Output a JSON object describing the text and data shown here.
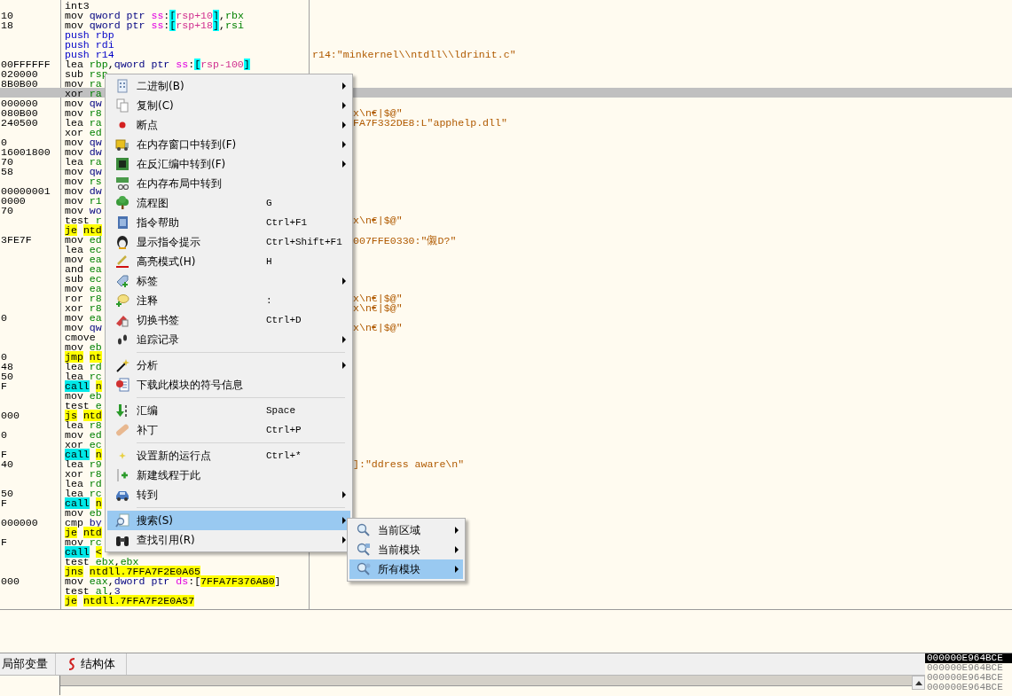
{
  "disassembly": {
    "rows": [
      {
        "code": [
          {
            "kind": "op",
            "text": "int3"
          }
        ],
        "selected": false
      },
      {
        "address": "10",
        "code": [
          {
            "kind": "op",
            "text": "mov "
          },
          {
            "kind": "ptr",
            "text": "qword ptr "
          },
          {
            "kind": "seg",
            "text": "ss"
          },
          {
            "kind": "op",
            "text": ":"
          },
          {
            "kind": "brk",
            "text": "["
          },
          {
            "kind": "mem",
            "text": "rsp+10"
          },
          {
            "kind": "brk",
            "text": "]"
          },
          {
            "kind": "op",
            "text": ","
          },
          {
            "kind": "reg",
            "text": "rbx"
          }
        ],
        "selected": false
      },
      {
        "address": "18",
        "code": [
          {
            "kind": "op",
            "text": "mov "
          },
          {
            "kind": "ptr",
            "text": "qword ptr "
          },
          {
            "kind": "seg",
            "text": "ss"
          },
          {
            "kind": "op",
            "text": ":"
          },
          {
            "kind": "brk",
            "text": "["
          },
          {
            "kind": "mem",
            "text": "rsp+18"
          },
          {
            "kind": "brk",
            "text": "]"
          },
          {
            "kind": "op",
            "text": ","
          },
          {
            "kind": "reg",
            "text": "rsi"
          }
        ],
        "selected": false
      },
      {
        "code": [
          {
            "kind": "stack",
            "text": "push rbp"
          }
        ],
        "selected": false
      },
      {
        "code": [
          {
            "kind": "stack",
            "text": "push rdi"
          }
        ],
        "selected": false
      },
      {
        "code": [
          {
            "kind": "stack",
            "text": "push r14"
          }
        ],
        "comment": "r14:\"minkernel\\\\ntdll\\\\ldrinit.c\"",
        "selected": false
      },
      {
        "address": "00FFFFFF",
        "code": [
          {
            "kind": "op",
            "text": "lea "
          },
          {
            "kind": "reg",
            "text": "rbp"
          },
          {
            "kind": "op",
            "text": ","
          },
          {
            "kind": "ptr",
            "text": "qword ptr "
          },
          {
            "kind": "seg",
            "text": "ss"
          },
          {
            "kind": "op",
            "text": ":"
          },
          {
            "kind": "brk",
            "text": "["
          },
          {
            "kind": "mem",
            "text": "rsp-100"
          },
          {
            "kind": "brk",
            "text": "]"
          }
        ],
        "selected": false
      },
      {
        "address": "020000",
        "code": [
          {
            "kind": "op",
            "text": "sub "
          },
          {
            "kind": "reg",
            "text": "rsp"
          }
        ],
        "selected": false
      },
      {
        "address": "8B0B00",
        "code": [
          {
            "kind": "op",
            "text": "mov "
          },
          {
            "kind": "reg",
            "text": "ra"
          }
        ],
        "selected": false
      },
      {
        "code": [
          {
            "kind": "op",
            "text": "xor "
          },
          {
            "kind": "reg",
            "text": "ra"
          }
        ],
        "selected": true
      },
      {
        "address": "000000",
        "code": [
          {
            "kind": "op",
            "text": "mov "
          },
          {
            "kind": "ptr",
            "text": "qw"
          }
        ],
        "selected": false
      },
      {
        "address": "080B00",
        "code": [
          {
            "kind": "op",
            "text": "mov "
          },
          {
            "kind": "reg",
            "text": "r8"
          }
        ],
        "comment": "x\\n€|$@\"",
        "selected": false
      },
      {
        "address": "240500",
        "code": [
          {
            "kind": "op",
            "text": "lea "
          },
          {
            "kind": "reg",
            "text": "ra"
          }
        ],
        "comment": "FA7F332DE8:L\"apphelp.dll\"",
        "selected": false
      },
      {
        "code": [
          {
            "kind": "op",
            "text": "xor "
          },
          {
            "kind": "reg",
            "text": "ed"
          }
        ],
        "selected": false
      },
      {
        "address": "0",
        "code": [
          {
            "kind": "op",
            "text": "mov "
          },
          {
            "kind": "ptr",
            "text": "qw"
          }
        ],
        "selected": false
      },
      {
        "address": "16001800",
        "code": [
          {
            "kind": "op",
            "text": "mov "
          },
          {
            "kind": "ptr",
            "text": "dw"
          }
        ],
        "selected": false
      },
      {
        "address": "70",
        "code": [
          {
            "kind": "op",
            "text": "lea "
          },
          {
            "kind": "reg",
            "text": "ra"
          }
        ],
        "selected": false
      },
      {
        "address": "58",
        "code": [
          {
            "kind": "op",
            "text": "mov "
          },
          {
            "kind": "ptr",
            "text": "qw"
          }
        ],
        "selected": false
      },
      {
        "code": [
          {
            "kind": "op",
            "text": "mov "
          },
          {
            "kind": "reg",
            "text": "rs"
          }
        ],
        "selected": false
      },
      {
        "address": "00000001",
        "code": [
          {
            "kind": "op",
            "text": "mov "
          },
          {
            "kind": "ptr",
            "text": "dw"
          }
        ],
        "selected": false
      },
      {
        "address": "0000",
        "code": [
          {
            "kind": "op",
            "text": "mov "
          },
          {
            "kind": "reg",
            "text": "r1"
          }
        ],
        "selected": false
      },
      {
        "address": "70",
        "code": [
          {
            "kind": "op",
            "text": "mov "
          },
          {
            "kind": "ptr",
            "text": "wo"
          }
        ],
        "selected": false
      },
      {
        "code": [
          {
            "kind": "op",
            "text": "test "
          },
          {
            "kind": "reg",
            "text": "r"
          }
        ],
        "comment": "x\\n€|$@\"",
        "selected": false
      },
      {
        "code": [
          {
            "kind": "jmp",
            "text": "je"
          },
          {
            "kind": "tgt",
            "text": "ntd"
          }
        ],
        "selected": false
      },
      {
        "address": "3FE7F",
        "code": [
          {
            "kind": "op",
            "text": "mov "
          },
          {
            "kind": "reg",
            "text": "ed"
          }
        ],
        "comment": "007FFE0330:\"儭D?\"",
        "selected": false
      },
      {
        "code": [
          {
            "kind": "op",
            "text": "lea "
          },
          {
            "kind": "reg",
            "text": "ec"
          }
        ],
        "selected": false
      },
      {
        "code": [
          {
            "kind": "op",
            "text": "mov "
          },
          {
            "kind": "reg",
            "text": "ea"
          }
        ],
        "selected": false
      },
      {
        "code": [
          {
            "kind": "op",
            "text": "and "
          },
          {
            "kind": "reg",
            "text": "ea"
          }
        ],
        "selected": false
      },
      {
        "code": [
          {
            "kind": "op",
            "text": "sub "
          },
          {
            "kind": "reg",
            "text": "ec"
          }
        ],
        "selected": false
      },
      {
        "code": [
          {
            "kind": "op",
            "text": "mov "
          },
          {
            "kind": "reg",
            "text": "ea"
          }
        ],
        "selected": false
      },
      {
        "code": [
          {
            "kind": "op",
            "text": "ror "
          },
          {
            "kind": "reg",
            "text": "r8"
          }
        ],
        "comment": "x\\n€|$@\"",
        "selected": false
      },
      {
        "code": [
          {
            "kind": "op",
            "text": "xor "
          },
          {
            "kind": "reg",
            "text": "r8"
          }
        ],
        "comment": "x\\n€|$@\"",
        "selected": false
      },
      {
        "address": "0",
        "code": [
          {
            "kind": "op",
            "text": "mov "
          },
          {
            "kind": "reg",
            "text": "ea"
          }
        ],
        "selected": false
      },
      {
        "code": [
          {
            "kind": "op",
            "text": "mov "
          },
          {
            "kind": "ptr",
            "text": "qw"
          }
        ],
        "comment": "x\\n€|$@\"",
        "selected": false
      },
      {
        "code": [
          {
            "kind": "op",
            "text": "cmove"
          }
        ],
        "selected": false
      },
      {
        "code": [
          {
            "kind": "op",
            "text": "mov "
          },
          {
            "kind": "reg",
            "text": "eb"
          }
        ],
        "selected": false
      },
      {
        "address": "0",
        "code": [
          {
            "kind": "jmp",
            "text": "jmp"
          },
          {
            "kind": "tgt",
            "text": "nt"
          }
        ],
        "selected": false
      },
      {
        "address": "48",
        "code": [
          {
            "kind": "op",
            "text": "lea "
          },
          {
            "kind": "reg",
            "text": "rd"
          }
        ],
        "selected": false
      },
      {
        "address": "50",
        "code": [
          {
            "kind": "op",
            "text": "lea "
          },
          {
            "kind": "reg",
            "text": "rc"
          }
        ],
        "selected": false
      },
      {
        "address": "F",
        "code": [
          {
            "kind": "call",
            "text": "call"
          },
          {
            "kind": "tgt",
            "text": "n"
          }
        ],
        "selected": false
      },
      {
        "code": [
          {
            "kind": "op",
            "text": "mov "
          },
          {
            "kind": "reg",
            "text": "eb"
          }
        ],
        "selected": false
      },
      {
        "code": [
          {
            "kind": "op",
            "text": "test "
          },
          {
            "kind": "reg",
            "text": "e"
          }
        ],
        "selected": false
      },
      {
        "address": "000",
        "code": [
          {
            "kind": "jmp",
            "text": "js"
          },
          {
            "kind": "tgt",
            "text": "ntd"
          }
        ],
        "selected": false
      },
      {
        "code": [
          {
            "kind": "op",
            "text": "lea "
          },
          {
            "kind": "reg",
            "text": "r8"
          }
        ],
        "selected": false
      },
      {
        "address": "0",
        "code": [
          {
            "kind": "op",
            "text": "mov "
          },
          {
            "kind": "reg",
            "text": "ed"
          }
        ],
        "selected": false
      },
      {
        "code": [
          {
            "kind": "op",
            "text": "xor "
          },
          {
            "kind": "reg",
            "text": "ec"
          }
        ],
        "selected": false
      },
      {
        "address": "F",
        "code": [
          {
            "kind": "call",
            "text": "call"
          },
          {
            "kind": "tgt",
            "text": "n"
          }
        ],
        "selected": false
      },
      {
        "address": "40",
        "code": [
          {
            "kind": "op",
            "text": "lea "
          },
          {
            "kind": "reg",
            "text": "r9"
          }
        ],
        "comment": "]:\"ddress aware\\n\"",
        "selected": false
      },
      {
        "code": [
          {
            "kind": "op",
            "text": "xor "
          },
          {
            "kind": "reg",
            "text": "r8"
          }
        ],
        "selected": false
      },
      {
        "code": [
          {
            "kind": "op",
            "text": "lea "
          },
          {
            "kind": "reg",
            "text": "rd"
          }
        ],
        "selected": false
      },
      {
        "address": "50",
        "code": [
          {
            "kind": "op",
            "text": "lea "
          },
          {
            "kind": "reg",
            "text": "rc"
          }
        ],
        "selected": false
      },
      {
        "address": "F",
        "code": [
          {
            "kind": "call",
            "text": "call"
          },
          {
            "kind": "tgt",
            "text": "n"
          }
        ],
        "selected": false
      },
      {
        "code": [
          {
            "kind": "op",
            "text": "mov "
          },
          {
            "kind": "reg",
            "text": "eb"
          }
        ],
        "selected": false
      },
      {
        "address": "000000",
        "code": [
          {
            "kind": "op",
            "text": "cmp "
          },
          {
            "kind": "ptr",
            "text": "by"
          }
        ],
        "selected": false
      },
      {
        "code": [
          {
            "kind": "jmp",
            "text": "je"
          },
          {
            "kind": "tgt",
            "text": "ntd"
          }
        ],
        "selected": false
      },
      {
        "address": "F",
        "code": [
          {
            "kind": "op",
            "text": "mov "
          },
          {
            "kind": "reg",
            "text": "rc"
          }
        ],
        "selected": false
      },
      {
        "code": [
          {
            "kind": "call",
            "text": "call"
          },
          {
            "kind": "tgt",
            "text": "<"
          }
        ],
        "selected": false
      },
      {
        "code": [
          {
            "kind": "op",
            "text": "test "
          },
          {
            "kind": "reg",
            "text": "ebx"
          },
          {
            "kind": "op",
            "text": ","
          },
          {
            "kind": "reg",
            "text": "ebx"
          }
        ],
        "selected": false
      },
      {
        "code": [
          {
            "kind": "jmp",
            "text": "jns"
          },
          {
            "kind": "tgt",
            "text": "ntdll.7FFA7F2E0A65"
          }
        ],
        "selected": false
      },
      {
        "address": "000",
        "code": [
          {
            "kind": "op",
            "text": "mov "
          },
          {
            "kind": "reg",
            "text": "eax"
          },
          {
            "kind": "op",
            "text": ","
          },
          {
            "kind": "ptr",
            "text": "dword ptr "
          },
          {
            "kind": "seg",
            "text": "ds"
          },
          {
            "kind": "op",
            "text": ":["
          },
          {
            "kind": "tgt",
            "text": "7FFA7F376AB0"
          },
          {
            "kind": "op",
            "text": "]"
          }
        ],
        "selected": false
      },
      {
        "code": [
          {
            "kind": "op",
            "text": "test "
          },
          {
            "kind": "reg",
            "text": "al"
          },
          {
            "kind": "op",
            "text": ","
          },
          {
            "kind": "num",
            "text": "3"
          }
        ],
        "selected": false
      },
      {
        "code": [
          {
            "kind": "jmp",
            "text": "je"
          },
          {
            "kind": "tgt",
            "text": "ntdll.7FFA7F2E0A57"
          }
        ],
        "selected": false
      }
    ]
  },
  "context_menu": {
    "sections": [
      [
        {
          "label": "二进制(B)",
          "submenu": true,
          "selected": false
        },
        {
          "label": "复制(C)",
          "submenu": true,
          "selected": false
        },
        {
          "label": "断点",
          "submenu": true,
          "selected": false
        },
        {
          "label": "在内存窗口中转到(F)",
          "submenu": true,
          "selected": false
        },
        {
          "label": "在反汇编中转到(F)",
          "submenu": true,
          "selected": false
        },
        {
          "label": "在内存布局中转到",
          "submenu": false,
          "selected": false
        },
        {
          "label": "流程图",
          "shortcut": "G",
          "submenu": false,
          "selected": false
        },
        {
          "label": "指令帮助",
          "shortcut": "Ctrl+F1",
          "submenu": false,
          "selected": false
        },
        {
          "label": "显示指令提示",
          "shortcut": "Ctrl+Shift+F1",
          "submenu": false,
          "selected": false
        },
        {
          "label": "高亮模式(H)",
          "shortcut": "H",
          "submenu": false,
          "selected": false
        },
        {
          "label": "标签",
          "submenu": true,
          "selected": false
        },
        {
          "label": "注释",
          "shortcut": ":",
          "submenu": false,
          "selected": false
        },
        {
          "label": "切换书签",
          "shortcut": "Ctrl+D",
          "submenu": false,
          "selected": false
        },
        {
          "label": "追踪记录",
          "submenu": true,
          "selected": false
        }
      ],
      [
        {
          "label": "分析",
          "submenu": true,
          "selected": false
        },
        {
          "label": "下载此模块的符号信息",
          "submenu": false,
          "selected": false
        }
      ],
      [
        {
          "label": "汇编",
          "shortcut": "Space",
          "submenu": false,
          "selected": false
        },
        {
          "label": "补丁",
          "shortcut": "Ctrl+P",
          "submenu": false,
          "selected": false
        }
      ],
      [
        {
          "label": "设置新的运行点",
          "shortcut": "Ctrl+*",
          "submenu": false,
          "selected": false
        },
        {
          "label": "新建线程于此",
          "submenu": false,
          "selected": false
        },
        {
          "label": "转到",
          "submenu": true,
          "selected": false
        }
      ],
      [
        {
          "label": "搜索(S)",
          "submenu": true,
          "selected": true
        },
        {
          "label": "查找引用(R)",
          "submenu": true,
          "selected": false
        }
      ]
    ]
  },
  "submenu": {
    "items": [
      {
        "label": "当前区域",
        "submenu": true,
        "selected": false
      },
      {
        "label": "当前模块",
        "submenu": true,
        "selected": false
      },
      {
        "label": "所有模块",
        "submenu": true,
        "selected": true
      }
    ]
  },
  "bottom_tabs": [
    {
      "label": "局部变量"
    },
    {
      "label": "结构体"
    }
  ],
  "dump": {
    "lines": [
      {
        "text": "000000E964BCE",
        "selected": true
      },
      {
        "text": "000000E964BCE",
        "selected": false
      },
      {
        "text": "000000E964BCE",
        "selected": false
      },
      {
        "text": "000000E964BCE",
        "selected": false
      }
    ]
  }
}
